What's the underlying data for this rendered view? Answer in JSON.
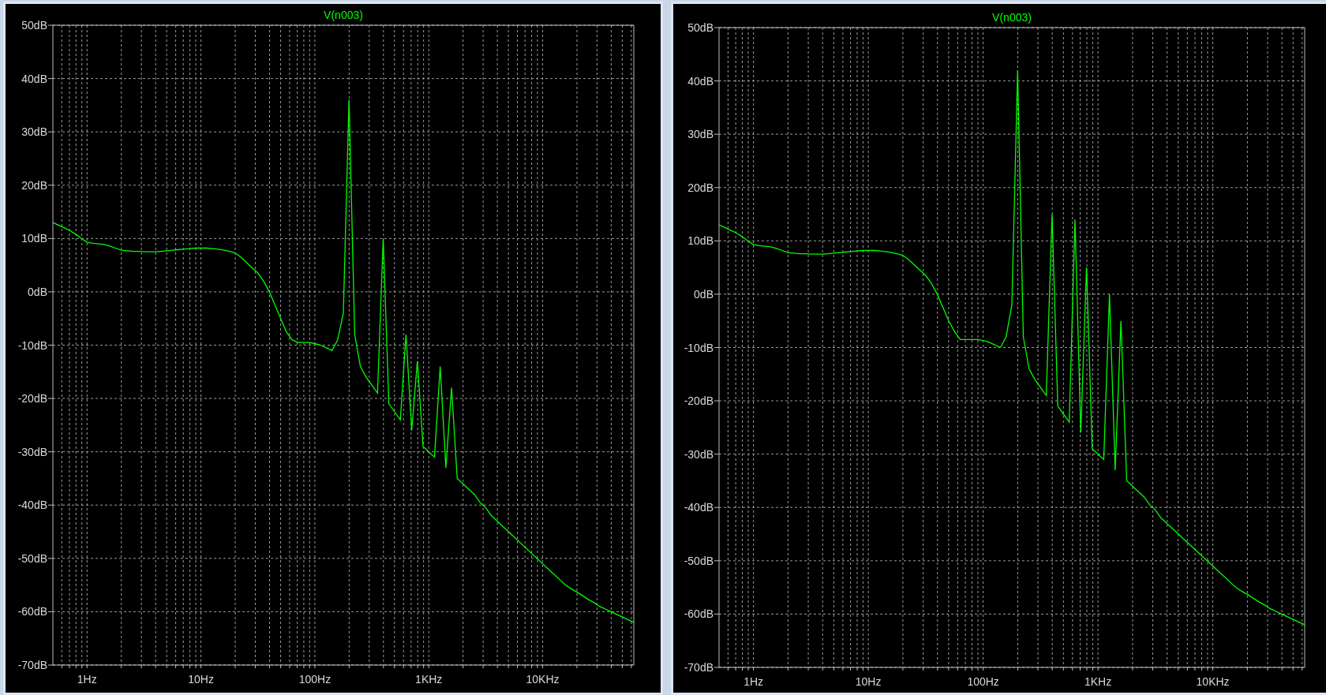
{
  "plots": [
    {
      "chart_data": {
        "type": "line",
        "ylim": [
          -70,
          50
        ],
        "categories": [
          null,
          null,
          null,
          null,
          null,
          null,
          "1Hz",
          null,
          null,
          null,
          null,
          null,
          null,
          null,
          null,
          null,
          null,
          null,
          null,
          null,
          null,
          null,
          null,
          null,
          null,
          null,
          "10Hz",
          null,
          null,
          null,
          null,
          null,
          null,
          null,
          null,
          null,
          null,
          null,
          null,
          null,
          null,
          null,
          null,
          null,
          null,
          null,
          "100Hz",
          null,
          null,
          null,
          null,
          null,
          null,
          null,
          null,
          null,
          null,
          null,
          null,
          null,
          null,
          null,
          null,
          null,
          null,
          null,
          "1KHz",
          null,
          null,
          null,
          null,
          null,
          null,
          null,
          null,
          null,
          null,
          null,
          null,
          null,
          null,
          null,
          null,
          null,
          null,
          null,
          "10KHz",
          null,
          null,
          null,
          null,
          null,
          null,
          null,
          null,
          null,
          null,
          null,
          null,
          null,
          null,
          null,
          null
        ],
        "yticks": [
          {
            "value": 50,
            "label": "50dB"
          },
          {
            "value": 40,
            "label": "40dB"
          },
          {
            "value": 30,
            "label": "30dB"
          },
          {
            "value": 20,
            "label": "20dB"
          },
          {
            "value": 10,
            "label": "10dB"
          },
          {
            "value": 0,
            "label": "0dB"
          },
          {
            "value": -10,
            "label": "-10dB"
          },
          {
            "value": -20,
            "label": "-20dB"
          },
          {
            "value": -30,
            "label": "-30dB"
          },
          {
            "value": -40,
            "label": "-40dB"
          },
          {
            "value": -50,
            "label": "-50dB"
          },
          {
            "value": -60,
            "label": "-60dB"
          },
          {
            "value": -70,
            "label": "-70dB"
          }
        ],
        "series": [
          {
            "name": "V(n003)",
            "color": "#00ff00",
            "values": [
              13,
              12.5,
              12,
              11.5,
              10.8,
              10,
              9.3,
              9.1,
              9,
              8.9,
              8.6,
              8.2,
              7.8,
              7.7,
              7.6,
              7.6,
              7.5,
              7.5,
              7.5,
              7.6,
              7.7,
              7.8,
              7.9,
              8,
              8.1,
              8.2,
              8.2,
              8.2,
              8.1,
              8,
              7.8,
              7.6,
              7.3,
              6.5,
              5.5,
              4.5,
              3.5,
              2,
              0,
              -2.5,
              -5,
              -7.5,
              -9,
              -9.5,
              -9.5,
              -9.5,
              -9.7,
              -10,
              -10.5,
              -11,
              -9,
              -4,
              36,
              -8,
              -14,
              -16,
              -17.5,
              -19,
              10,
              -21,
              -22.5,
              -24,
              -8,
              -26,
              -13,
              -29,
              -30,
              -31,
              -14,
              -33,
              -18,
              -35,
              -36,
              -37,
              -38,
              -39.5,
              -40.5,
              -42,
              -43,
              -44,
              -45,
              -46,
              -47,
              -48,
              -49,
              -50,
              -51,
              -52,
              -53,
              -54,
              -55,
              -55.7,
              -56.3,
              -57,
              -57.7,
              -58.3,
              -59,
              -59.5,
              -60,
              -60.5,
              -61,
              -61.5,
              -62
            ]
          }
        ],
        "grid": true
      }
    },
    {
      "chart_data": {
        "type": "line",
        "ylim": [
          -70,
          50
        ],
        "categories": [
          null,
          null,
          null,
          null,
          null,
          null,
          "1Hz",
          null,
          null,
          null,
          null,
          null,
          null,
          null,
          null,
          null,
          null,
          null,
          null,
          null,
          null,
          null,
          null,
          null,
          null,
          null,
          "10Hz",
          null,
          null,
          null,
          null,
          null,
          null,
          null,
          null,
          null,
          null,
          null,
          null,
          null,
          null,
          null,
          null,
          null,
          null,
          null,
          "100Hz",
          null,
          null,
          null,
          null,
          null,
          null,
          null,
          null,
          null,
          null,
          null,
          null,
          null,
          null,
          null,
          null,
          null,
          null,
          null,
          "1KHz",
          null,
          null,
          null,
          null,
          null,
          null,
          null,
          null,
          null,
          null,
          null,
          null,
          null,
          null,
          null,
          null,
          null,
          null,
          null,
          "10KHz",
          null,
          null,
          null,
          null,
          null,
          null,
          null,
          null,
          null,
          null,
          null,
          null,
          null,
          null,
          null,
          null
        ],
        "yticks": [
          {
            "value": 50,
            "label": "50dB"
          },
          {
            "value": 40,
            "label": "40dB"
          },
          {
            "value": 30,
            "label": "30dB"
          },
          {
            "value": 20,
            "label": "20dB"
          },
          {
            "value": 10,
            "label": "10dB"
          },
          {
            "value": 0,
            "label": "0dB"
          },
          {
            "value": -10,
            "label": "-10dB"
          },
          {
            "value": -20,
            "label": "-20dB"
          },
          {
            "value": -30,
            "label": "-30dB"
          },
          {
            "value": -40,
            "label": "-40dB"
          },
          {
            "value": -50,
            "label": "-50dB"
          },
          {
            "value": -60,
            "label": "-60dB"
          },
          {
            "value": -70,
            "label": "-70dB"
          }
        ],
        "series": [
          {
            "name": "V(n003)",
            "color": "#00ff00",
            "values": [
              13,
              12.5,
              12,
              11.5,
              10.8,
              10,
              9.3,
              9.1,
              9,
              8.9,
              8.6,
              8.2,
              7.8,
              7.7,
              7.6,
              7.6,
              7.5,
              7.5,
              7.5,
              7.6,
              7.7,
              7.8,
              7.9,
              8,
              8.1,
              8.2,
              8.2,
              8.2,
              8.1,
              8,
              7.8,
              7.6,
              7.3,
              6.5,
              5.5,
              4.5,
              3.5,
              2,
              0,
              -2.5,
              -5,
              -7,
              -8.5,
              -8.5,
              -8.5,
              -8.5,
              -8.7,
              -9,
              -9.5,
              -10,
              -8,
              -2,
              42,
              -8,
              -14,
              -16,
              -17.5,
              -19,
              15,
              -21,
              -22.5,
              -24,
              14,
              -26,
              5,
              -29,
              -30,
              -31,
              0,
              -33,
              -5,
              -35,
              -36,
              -37,
              -38,
              -39.5,
              -40.5,
              -42,
              -43,
              -44,
              -45,
              -46,
              -47,
              -48,
              -49,
              -50,
              -51,
              -52,
              -53,
              -54,
              -55,
              -55.7,
              -56.3,
              -57,
              -57.7,
              -58.3,
              -59,
              -59.5,
              -60,
              -60.5,
              -61,
              -61.5,
              -62
            ]
          }
        ],
        "grid": true
      }
    }
  ]
}
